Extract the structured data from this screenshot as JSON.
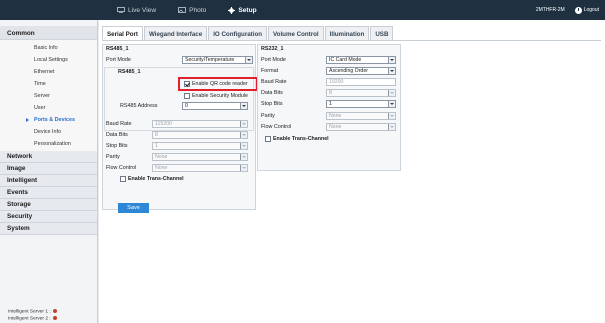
{
  "topbar": {
    "nav": [
      {
        "label": "Live View",
        "icon": "monitor-icon"
      },
      {
        "label": "Photo",
        "icon": "photo-icon"
      },
      {
        "label": "Setup",
        "icon": "gear-icon",
        "active": true
      }
    ],
    "device": "2MTHFR-2M",
    "logout": "Logout"
  },
  "sidebar": {
    "common": "Common",
    "items": [
      "Basic Info",
      "Local Settings",
      "Ethernet",
      "Time",
      "Server",
      "User",
      "Ports & Devices",
      "Device Info",
      "Personalization"
    ],
    "active_item": "Ports & Devices",
    "groups": [
      "Network",
      "Image",
      "Intelligent",
      "Events",
      "Storage",
      "Security",
      "System"
    ],
    "status": [
      {
        "label": "Intelligent Server 1 :",
        "color": "#c0442c"
      },
      {
        "label": "Intelligent Server 2 :",
        "color": "#c0442c"
      }
    ]
  },
  "tabs": [
    "Serial Port",
    "Wiegand Interface",
    "IO Configuration",
    "Volume Control",
    "Illumination",
    "USB"
  ],
  "rs485": {
    "title": "RS485_1",
    "port_mode_label": "Port Mode",
    "port_mode_value": "Security/Temperature",
    "sub_title": "RS485_1",
    "qr_label": "Enable QR code reader",
    "qr_checked": true,
    "security_module_label": "Enable Security Module",
    "security_module_checked": false,
    "address_label": "RS485 Address",
    "address_value": "0",
    "baud_label": "Baud Rate",
    "baud_value": "115200",
    "data_bits_label": "Data Bits",
    "data_bits_value": "8",
    "stop_bits_label": "Stop Bits",
    "stop_bits_value": "1",
    "parity_label": "Parity",
    "parity_value": "None",
    "flow_label": "Flow Control",
    "flow_value": "None",
    "trans_label": "Enable Trans-Channel"
  },
  "rs232": {
    "title": "RS232_1",
    "port_mode_label": "Port Mode",
    "port_mode_value": "IC Card Mode",
    "format_label": "Format",
    "format_value": "Ascending Order",
    "baud_label": "Baud Rate",
    "baud_value": "19200",
    "data_bits_label": "Data Bits",
    "data_bits_value": "8",
    "stop_bits_label": "Stop Bits",
    "stop_bits_value": "1",
    "parity_label": "Parity",
    "parity_value": "None",
    "flow_label": "Flow Control",
    "flow_value": "None",
    "trans_label": "Enable Trans-Channel"
  },
  "save_label": "Save",
  "colors": {
    "topbar": "#1f3141",
    "accent": "#2e86d6",
    "highlight": "#e0202a",
    "status_dot": "#c0442c"
  }
}
